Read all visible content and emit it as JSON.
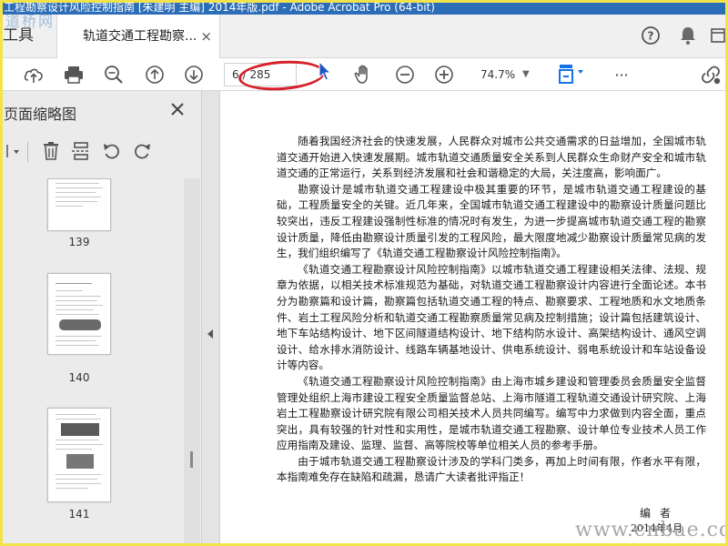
{
  "window": {
    "title": "工程勘察设计风险控制指南 [朱建明 主编] 2014年版.pdf - Adobe Acrobat Pro (64-bit)"
  },
  "watermark": {
    "top": "道桥网",
    "bottom": "www.cnbae.com"
  },
  "tabs": {
    "tools_label": "工具",
    "document_label": "轨道交通工程勘察...",
    "close_glyph": "×"
  },
  "icons": {
    "help": "help-icon",
    "bell": "bell-icon",
    "overflow": "sidebar-toggle-icon"
  },
  "toolbar": {
    "current_page": "6",
    "total_pages": "/ 285",
    "zoom": "74.7%",
    "more": "···"
  },
  "sidebar": {
    "title": "页面缩略图",
    "close_glyph": "×",
    "thumbnails": [
      {
        "label": "139"
      },
      {
        "label": "140"
      },
      {
        "label": "141"
      }
    ]
  },
  "document": {
    "paragraphs": [
      "随着我国经济社会的快速发展，人民群众对城市公共交通需求的日益增加，全国城市轨道交通开始进入快速发展期。城市轨道交通质量安全关系到人民群众生命财产安全和城市轨道交通的正常运行，关系到经济发展和社会和谐稳定的大局，关注度高，影响面广。",
      "勘察设计是城市轨道交通工程建设中极其重要的环节，是城市轨道交通工程建设的基础，工程质量安全的关键。近几年来，全国城市轨道交通工程建设中的勘察设计质量问题比较突出，违反工程建设强制性标准的情况时有发生，为进一步提高城市轨道交通工程的勘察设计质量，降低由勘察设计质量引发的工程风险，最大限度地减少勘察设计质量常见病的发生，我们组织编写了《轨道交通工程勘察设计风险控制指南》。",
      "《轨道交通工程勘察设计风险控制指南》以城市轨道交通工程建设相关法律、法规、规章为依据，以相关技术标准规范为基础，对轨道交通工程勘察设计内容进行全面论述。本书分为勘察篇和设计篇，勘察篇包括轨道交通工程的特点、勘察要求、工程地质和水文地质条件、岩土工程风险分析和轨道交通工程勘察质量常见病及控制措施；设计篇包括建筑设计、地下车站结构设计、地下区间隧道结构设计、地下结构防水设计、高架结构设计、通风空调设计、给水排水消防设计、线路车辆基地设计、供电系统设计、弱电系统设计和车站设备设计等内容。",
      "《轨道交通工程勘察设计风险控制指南》由上海市城乡建设和管理委员会质量安全监督管理处组织上海市建设工程安全质量监督总站、上海市隧道工程轨道交通设计研究院、上海岩土工程勘察设计研究院有限公司相关技术人员共同编写。编写中力求做到内容全面，重点突出，具有较强的针对性和实用性，是城市轨道交通工程勘察、设计单位专业技术人员工作应用指南及建设、监理、监督、高等院校等单位相关人员的参考手册。",
      "由于城市轨道交通工程勘察设计涉及的学科门类多，再加上时间有限，作者水平有限，本指南难免存在缺陷和疏漏，恳请广大读者批评指正！"
    ],
    "signature": "编者",
    "date": "2014年4月"
  },
  "colors": {
    "accent_blue": "#1473e6",
    "annotation_red": "#d6202a",
    "frame_yellow": "#f3e34a"
  }
}
